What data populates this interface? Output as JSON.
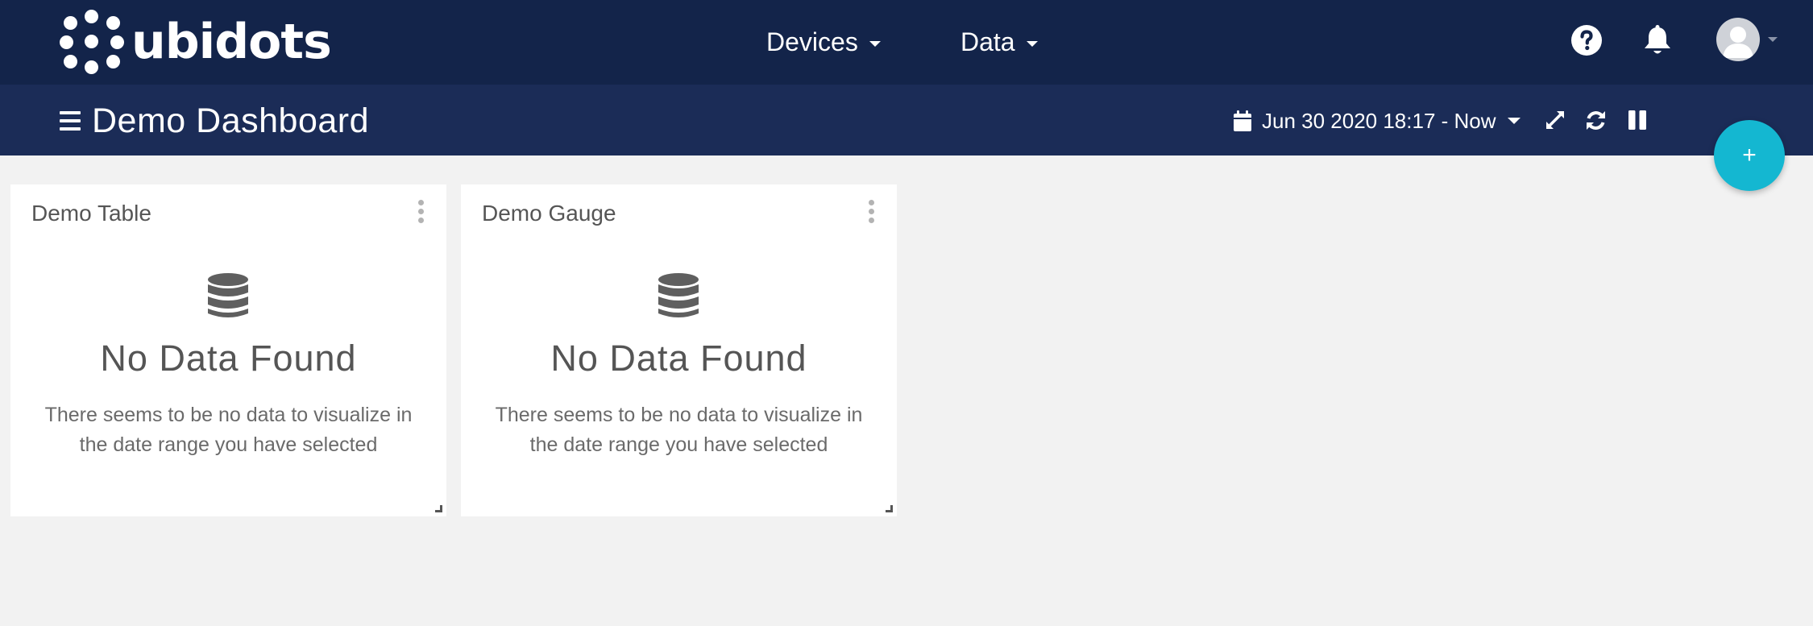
{
  "app": {
    "brand": "ubidots"
  },
  "topnav": {
    "items": [
      {
        "label": "Devices"
      },
      {
        "label": "Data"
      }
    ]
  },
  "dashboard": {
    "title": "Demo Dashboard",
    "date_range": "Jun 30 2020 18:17 - Now"
  },
  "fab": {
    "label": "+"
  },
  "widgets": [
    {
      "title": "Demo Table",
      "empty_title": "No Data Found",
      "empty_text": "There seems to be no data to visualize in the date range you have selected"
    },
    {
      "title": "Demo Gauge",
      "empty_title": "No Data Found",
      "empty_text": "There seems to be no data to visualize in the date range you have selected"
    }
  ],
  "colors": {
    "topbar": "#13244a",
    "subbar": "#1b2c57",
    "fab": "#14b7d1",
    "background": "#f2f2f2"
  },
  "icons": [
    "help-icon",
    "bell-icon",
    "calendar-icon",
    "expand-icon",
    "refresh-icon",
    "pause-icon",
    "database-icon",
    "kebab-menu-icon",
    "hamburger-menu-icon"
  ]
}
